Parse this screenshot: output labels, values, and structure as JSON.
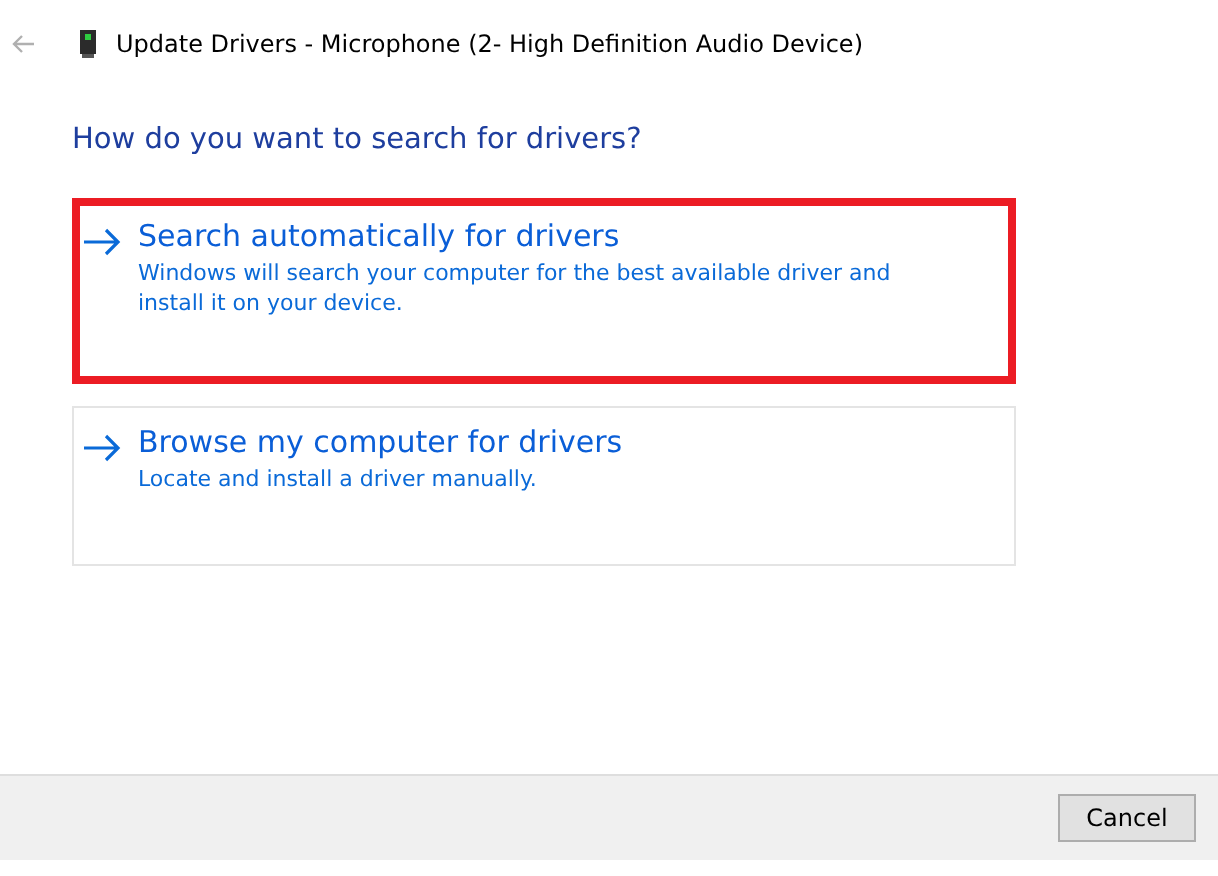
{
  "window": {
    "title": "Update Drivers - Microphone (2- High Definition Audio Device)"
  },
  "heading": "How do you want to search for drivers?",
  "options": [
    {
      "title": "Search automatically for drivers",
      "description": "Windows will search your computer for the best available driver and install it on your device.",
      "highlighted": true
    },
    {
      "title": "Browse my computer for drivers",
      "description": "Locate and install a driver manually.",
      "highlighted": false
    }
  ],
  "buttons": [
    "Cancel"
  ]
}
